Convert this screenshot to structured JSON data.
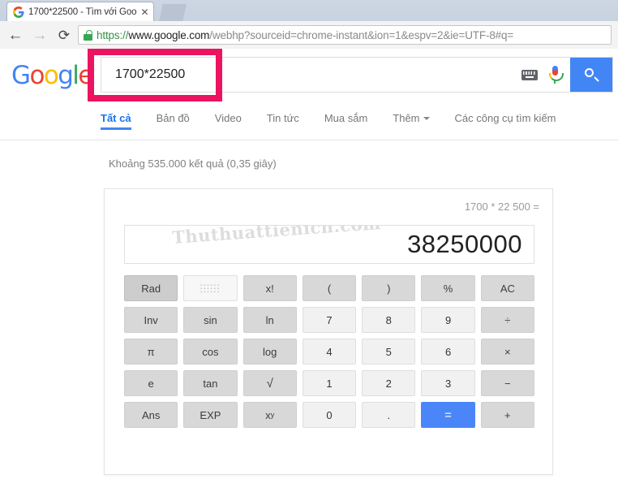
{
  "browser": {
    "tab": {
      "title": "1700*22500 - Tìm với Goo",
      "favicon_icon": "google-g-icon",
      "close_icon": "close-icon"
    },
    "nav": {
      "back_icon": "back-arrow-icon",
      "forward_icon": "forward-arrow-icon",
      "reload_icon": "reload-icon"
    },
    "omnibox": {
      "lock_icon": "lock-icon",
      "scheme": "https://",
      "host": "www.google.com",
      "path": "/webhp?sourceid=chrome-instant&ion=1&espv=2&ie=UTF-8#q="
    }
  },
  "google": {
    "logo": [
      "G",
      "o",
      "o",
      "g",
      "l",
      "e"
    ],
    "search": {
      "value": "1700*22500",
      "placeholder": "",
      "keyboard_icon": "keyboard-icon",
      "mic_icon": "microphone-icon",
      "search_icon": "search-icon"
    },
    "highlight_color": "#ec1360",
    "tabs": [
      {
        "label": "Tất cả",
        "active": true
      },
      {
        "label": "Bản đồ",
        "active": false
      },
      {
        "label": "Video",
        "active": false
      },
      {
        "label": "Tin tức",
        "active": false
      },
      {
        "label": "Mua sắm",
        "active": false
      },
      {
        "label": "Thêm",
        "active": false,
        "has_caret": true
      },
      {
        "label": "Các công cụ tìm kiếm",
        "active": false
      }
    ],
    "result_stats": "Khoảng 535.000 kết quả (0,35 giây)"
  },
  "calculator": {
    "expression": "1700 * 22 500 =",
    "result": "38250000",
    "watermark": "Thuthuattienich.com",
    "accent_color": "#4a86f7",
    "keys": [
      {
        "label": "Rad",
        "type": "sel"
      },
      {
        "label": "",
        "type": "grid"
      },
      {
        "label": "x!",
        "type": "fn"
      },
      {
        "label": "(",
        "type": "fn"
      },
      {
        "label": ")",
        "type": "fn"
      },
      {
        "label": "%",
        "type": "fn"
      },
      {
        "label": "AC",
        "type": "fn"
      },
      {
        "label": "Inv",
        "type": "fn"
      },
      {
        "label": "sin",
        "type": "fn"
      },
      {
        "label": "ln",
        "type": "fn"
      },
      {
        "label": "7",
        "type": "num"
      },
      {
        "label": "8",
        "type": "num"
      },
      {
        "label": "9",
        "type": "num"
      },
      {
        "label": "÷",
        "type": "fn"
      },
      {
        "label": "π",
        "type": "fn"
      },
      {
        "label": "cos",
        "type": "fn"
      },
      {
        "label": "log",
        "type": "fn"
      },
      {
        "label": "4",
        "type": "num"
      },
      {
        "label": "5",
        "type": "num"
      },
      {
        "label": "6",
        "type": "num"
      },
      {
        "label": "×",
        "type": "fn"
      },
      {
        "label": "e",
        "type": "fn"
      },
      {
        "label": "tan",
        "type": "fn"
      },
      {
        "label": "√",
        "type": "fn"
      },
      {
        "label": "1",
        "type": "num"
      },
      {
        "label": "2",
        "type": "num"
      },
      {
        "label": "3",
        "type": "num"
      },
      {
        "label": "−",
        "type": "fn"
      },
      {
        "label": "Ans",
        "type": "fn"
      },
      {
        "label": "EXP",
        "type": "fn"
      },
      {
        "label": "xy",
        "type": "pow"
      },
      {
        "label": "0",
        "type": "num"
      },
      {
        "label": ".",
        "type": "num"
      },
      {
        "label": "=",
        "type": "eq"
      },
      {
        "label": "+",
        "type": "fn"
      }
    ]
  }
}
